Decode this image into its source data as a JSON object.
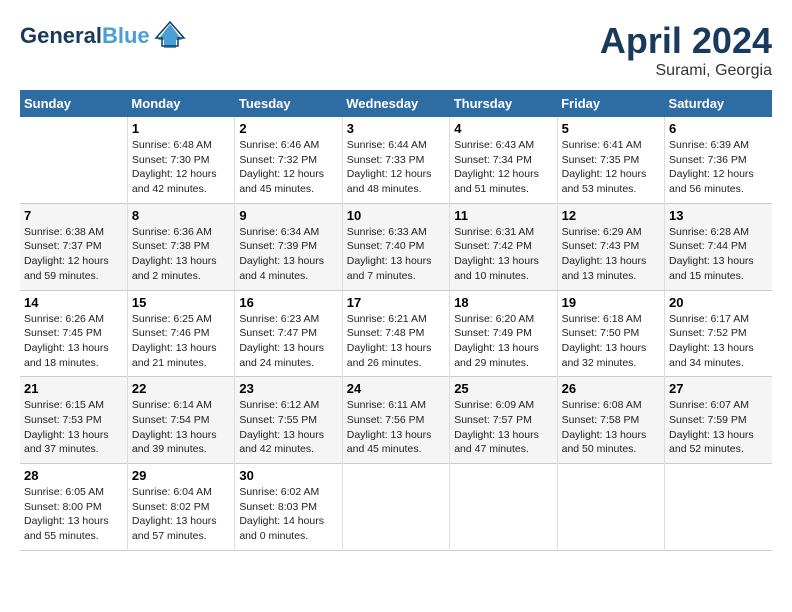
{
  "header": {
    "logo_line1": "General",
    "logo_line2": "Blue",
    "month": "April 2024",
    "location": "Surami, Georgia"
  },
  "days_of_week": [
    "Sunday",
    "Monday",
    "Tuesday",
    "Wednesday",
    "Thursday",
    "Friday",
    "Saturday"
  ],
  "weeks": [
    [
      {
        "num": "",
        "info": ""
      },
      {
        "num": "1",
        "info": "Sunrise: 6:48 AM\nSunset: 7:30 PM\nDaylight: 12 hours\nand 42 minutes."
      },
      {
        "num": "2",
        "info": "Sunrise: 6:46 AM\nSunset: 7:32 PM\nDaylight: 12 hours\nand 45 minutes."
      },
      {
        "num": "3",
        "info": "Sunrise: 6:44 AM\nSunset: 7:33 PM\nDaylight: 12 hours\nand 48 minutes."
      },
      {
        "num": "4",
        "info": "Sunrise: 6:43 AM\nSunset: 7:34 PM\nDaylight: 12 hours\nand 51 minutes."
      },
      {
        "num": "5",
        "info": "Sunrise: 6:41 AM\nSunset: 7:35 PM\nDaylight: 12 hours\nand 53 minutes."
      },
      {
        "num": "6",
        "info": "Sunrise: 6:39 AM\nSunset: 7:36 PM\nDaylight: 12 hours\nand 56 minutes."
      }
    ],
    [
      {
        "num": "7",
        "info": "Sunrise: 6:38 AM\nSunset: 7:37 PM\nDaylight: 12 hours\nand 59 minutes."
      },
      {
        "num": "8",
        "info": "Sunrise: 6:36 AM\nSunset: 7:38 PM\nDaylight: 13 hours\nand 2 minutes."
      },
      {
        "num": "9",
        "info": "Sunrise: 6:34 AM\nSunset: 7:39 PM\nDaylight: 13 hours\nand 4 minutes."
      },
      {
        "num": "10",
        "info": "Sunrise: 6:33 AM\nSunset: 7:40 PM\nDaylight: 13 hours\nand 7 minutes."
      },
      {
        "num": "11",
        "info": "Sunrise: 6:31 AM\nSunset: 7:42 PM\nDaylight: 13 hours\nand 10 minutes."
      },
      {
        "num": "12",
        "info": "Sunrise: 6:29 AM\nSunset: 7:43 PM\nDaylight: 13 hours\nand 13 minutes."
      },
      {
        "num": "13",
        "info": "Sunrise: 6:28 AM\nSunset: 7:44 PM\nDaylight: 13 hours\nand 15 minutes."
      }
    ],
    [
      {
        "num": "14",
        "info": "Sunrise: 6:26 AM\nSunset: 7:45 PM\nDaylight: 13 hours\nand 18 minutes."
      },
      {
        "num": "15",
        "info": "Sunrise: 6:25 AM\nSunset: 7:46 PM\nDaylight: 13 hours\nand 21 minutes."
      },
      {
        "num": "16",
        "info": "Sunrise: 6:23 AM\nSunset: 7:47 PM\nDaylight: 13 hours\nand 24 minutes."
      },
      {
        "num": "17",
        "info": "Sunrise: 6:21 AM\nSunset: 7:48 PM\nDaylight: 13 hours\nand 26 minutes."
      },
      {
        "num": "18",
        "info": "Sunrise: 6:20 AM\nSunset: 7:49 PM\nDaylight: 13 hours\nand 29 minutes."
      },
      {
        "num": "19",
        "info": "Sunrise: 6:18 AM\nSunset: 7:50 PM\nDaylight: 13 hours\nand 32 minutes."
      },
      {
        "num": "20",
        "info": "Sunrise: 6:17 AM\nSunset: 7:52 PM\nDaylight: 13 hours\nand 34 minutes."
      }
    ],
    [
      {
        "num": "21",
        "info": "Sunrise: 6:15 AM\nSunset: 7:53 PM\nDaylight: 13 hours\nand 37 minutes."
      },
      {
        "num": "22",
        "info": "Sunrise: 6:14 AM\nSunset: 7:54 PM\nDaylight: 13 hours\nand 39 minutes."
      },
      {
        "num": "23",
        "info": "Sunrise: 6:12 AM\nSunset: 7:55 PM\nDaylight: 13 hours\nand 42 minutes."
      },
      {
        "num": "24",
        "info": "Sunrise: 6:11 AM\nSunset: 7:56 PM\nDaylight: 13 hours\nand 45 minutes."
      },
      {
        "num": "25",
        "info": "Sunrise: 6:09 AM\nSunset: 7:57 PM\nDaylight: 13 hours\nand 47 minutes."
      },
      {
        "num": "26",
        "info": "Sunrise: 6:08 AM\nSunset: 7:58 PM\nDaylight: 13 hours\nand 50 minutes."
      },
      {
        "num": "27",
        "info": "Sunrise: 6:07 AM\nSunset: 7:59 PM\nDaylight: 13 hours\nand 52 minutes."
      }
    ],
    [
      {
        "num": "28",
        "info": "Sunrise: 6:05 AM\nSunset: 8:00 PM\nDaylight: 13 hours\nand 55 minutes."
      },
      {
        "num": "29",
        "info": "Sunrise: 6:04 AM\nSunset: 8:02 PM\nDaylight: 13 hours\nand 57 minutes."
      },
      {
        "num": "30",
        "info": "Sunrise: 6:02 AM\nSunset: 8:03 PM\nDaylight: 14 hours\nand 0 minutes."
      },
      {
        "num": "",
        "info": ""
      },
      {
        "num": "",
        "info": ""
      },
      {
        "num": "",
        "info": ""
      },
      {
        "num": "",
        "info": ""
      }
    ]
  ]
}
